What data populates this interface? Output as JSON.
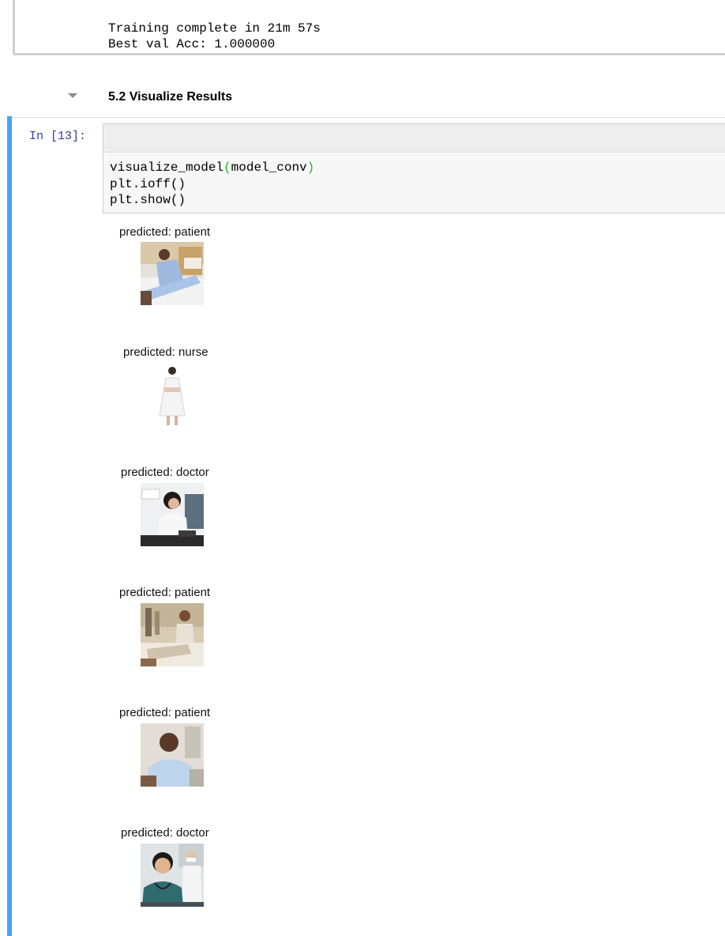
{
  "previous_output": {
    "lines": [
      "Training complete in 21m 57s",
      "Best val Acc: 1.000000"
    ]
  },
  "markdown_cell": {
    "heading": "5.2 Visualize Results"
  },
  "code_cell": {
    "prompt": "In [13]:",
    "code": {
      "line1_func": "visualize_model",
      "line1_open": "(",
      "line1_arg": "model_conv",
      "line1_close": ")",
      "line2": "plt.ioff()",
      "line3": "plt.show()"
    }
  },
  "outputs": [
    {
      "label": "predicted: patient",
      "thumbnail": "patient-in-hospital-bed-photo"
    },
    {
      "label": "predicted: nurse",
      "thumbnail": "nurse-in-white-uniform-photo"
    },
    {
      "label": "predicted: doctor",
      "thumbnail": "doctor-at-desk-photo"
    },
    {
      "label": "predicted: patient",
      "thumbnail": "patient-in-ward-photo"
    },
    {
      "label": "predicted: patient",
      "thumbnail": "seated-patient-photo"
    },
    {
      "label": "predicted: doctor",
      "thumbnail": "doctor-with-stethoscope-photo"
    }
  ],
  "colors": {
    "selected_cell_bar": "#42a5f5",
    "prompt": "#303f9f",
    "paren_highlight": "#22bb22"
  }
}
